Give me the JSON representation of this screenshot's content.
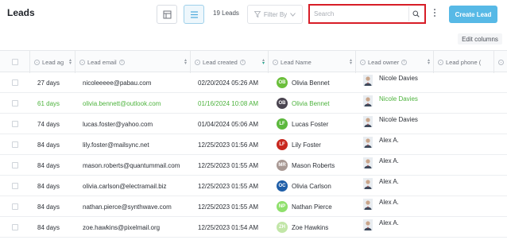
{
  "header": {
    "title": "Leads",
    "lead_count": "19 Leads",
    "filter_label": "Filter By",
    "search_placeholder": "Search",
    "create_label": "Create Lead",
    "edit_columns_label": "Edit columns"
  },
  "table": {
    "columns": [
      "Lead ag",
      "Lead email",
      "Lead created",
      "Lead Name",
      "Lead owner",
      "Lead phone ("
    ],
    "sort_column": "Lead created",
    "rows": [
      {
        "age": "27 days",
        "email": "nicoleeeee@pabau.com",
        "created": "02/20/2024 05:26 AM",
        "initials": "OB",
        "avatar_color": "#6bbf3b",
        "name": "Olivia Bennet",
        "owner": "Nicole Davies",
        "highlight": false
      },
      {
        "age": "61 days",
        "email": "olivia.bennett@outlook.com",
        "created": "01/16/2024 10:08 AM",
        "initials": "OB",
        "avatar_color": "#4a4450",
        "name": "Olivia Bennet",
        "owner": "Nicole Davies",
        "highlight": true
      },
      {
        "age": "74 days",
        "email": "lucas.foster@yahoo.com",
        "created": "01/04/2024 05:06 AM",
        "initials": "LF",
        "avatar_color": "#5cb83d",
        "name": "Lucas Foster",
        "owner": "Nicole Davies",
        "highlight": false
      },
      {
        "age": "84 days",
        "email": "lily.foster@mailsync.net",
        "created": "12/25/2023 01:56 AM",
        "initials": "LF",
        "avatar_color": "#c8281f",
        "name": "Lily Foster",
        "owner": "Alex A.",
        "highlight": false
      },
      {
        "age": "84 days",
        "email": "mason.roberts@quantummail.com",
        "created": "12/25/2023 01:55 AM",
        "initials": "MR",
        "avatar_color": "#a89893",
        "name": "Mason Roberts",
        "owner": "Alex A.",
        "highlight": false
      },
      {
        "age": "84 days",
        "email": "olivia.carlson@electramail.biz",
        "created": "12/25/2023 01:55 AM",
        "initials": "OC",
        "avatar_color": "#1f5ea8",
        "name": "Olivia Carlson",
        "owner": "Alex A.",
        "highlight": false
      },
      {
        "age": "84 days",
        "email": "nathan.pierce@synthwave.com",
        "created": "12/25/2023 01:55 AM",
        "initials": "NP",
        "avatar_color": "#8fe06c",
        "name": "Nathan Pierce",
        "owner": "Alex A.",
        "highlight": false
      },
      {
        "age": "84 days",
        "email": "zoe.hawkins@pixelmail.org",
        "created": "12/25/2023 01:54 AM",
        "initials": "ZH",
        "avatar_color": "#c2e6a8",
        "name": "Zoe Hawkins",
        "owner": "Alex A.",
        "highlight": false
      }
    ]
  },
  "colors": {
    "accent": "#57b9e6",
    "highlight_text": "#4db33d",
    "search_outline": "#d71d27"
  }
}
